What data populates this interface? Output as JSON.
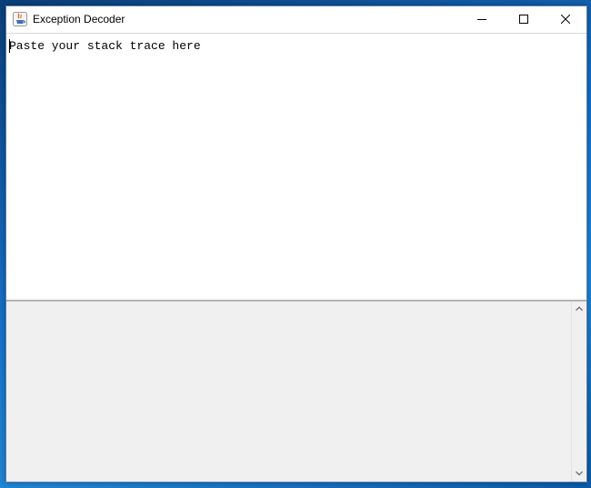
{
  "window": {
    "title": "Exception Decoder",
    "icon": "java-coffee-icon"
  },
  "title_controls": {
    "minimize_icon": "minimize-icon",
    "maximize_icon": "maximize-icon",
    "close_icon": "close-icon"
  },
  "editor": {
    "placeholder": "Paste your stack trace here",
    "value": ""
  },
  "output": {
    "value": ""
  },
  "scrollbar": {
    "up_icon": "chevron-up-icon",
    "down_icon": "chevron-down-icon"
  },
  "colors": {
    "desktop": "#1670c9",
    "output_bg": "#f0f0f0",
    "window_border": "#5a7ea6"
  }
}
